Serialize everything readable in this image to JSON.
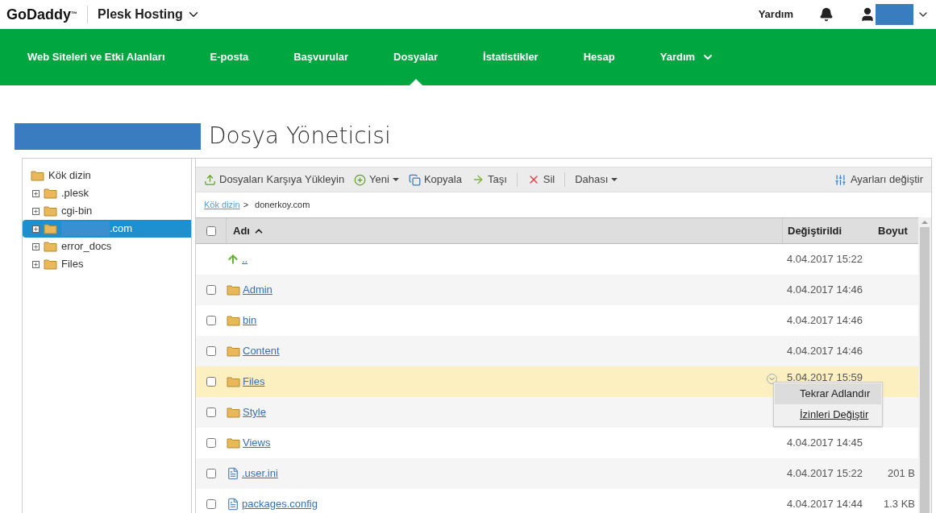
{
  "header": {
    "brand": "GoDaddy",
    "trademark": "™",
    "product": "Plesk Hosting",
    "help": "Yardım"
  },
  "nav": [
    {
      "label": "Web Siteleri ve Etki Alanları",
      "selected": false,
      "dropdown": false
    },
    {
      "label": "E-posta",
      "selected": false,
      "dropdown": false
    },
    {
      "label": "Başvurular",
      "selected": false,
      "dropdown": false
    },
    {
      "label": "Dosyalar",
      "selected": true,
      "dropdown": false
    },
    {
      "label": "İstatistikler",
      "selected": false,
      "dropdown": false
    },
    {
      "label": "Hesap",
      "selected": false,
      "dropdown": false
    },
    {
      "label": "Yardım",
      "selected": false,
      "dropdown": true
    }
  ],
  "page_title": "Dosya Yöneticisi",
  "tree": {
    "root": "Kök dizin",
    "children": [
      {
        "label": ".plesk",
        "selected": false,
        "redacted": false
      },
      {
        "label": "cgi-bin",
        "selected": false,
        "redacted": false
      },
      {
        "label": ".com",
        "selected": true,
        "redacted": true
      },
      {
        "label": "error_docs",
        "selected": false,
        "redacted": false
      },
      {
        "label": "Files",
        "selected": false,
        "redacted": false
      }
    ]
  },
  "toolbar": [
    {
      "label": "Dosyaları Karşıya Yükleyin",
      "kind": "upload"
    },
    {
      "label": "Yeni",
      "kind": "new"
    },
    {
      "label": "Kopyala",
      "kind": "copy"
    },
    {
      "label": "Taşı",
      "kind": "move"
    },
    {
      "label": "Sil",
      "kind": "delete"
    },
    {
      "label": "Dahası",
      "kind": "more"
    }
  ],
  "settings": "Ayarları değiştir",
  "breadcrumb": {
    "link": "Kök dizin",
    "separator": ">",
    "current": "donerkoy.com"
  },
  "table": {
    "select_all_checked": false,
    "columns": [
      "Adı",
      "Değiştirildi",
      "Boyut"
    ],
    "rows": [
      {
        "name": "..",
        "kind": "up",
        "modified": "4.04.2017 15:22",
        "size": "",
        "highlighted": false
      },
      {
        "checked": false,
        "name": "Admin",
        "kind": "folder",
        "modified": "4.04.2017 14:46",
        "size": "",
        "highlighted": false
      },
      {
        "checked": false,
        "name": "bin",
        "kind": "folder",
        "modified": "4.04.2017 14:46",
        "size": "",
        "highlighted": false
      },
      {
        "checked": false,
        "name": "Content",
        "kind": "folder",
        "modified": "4.04.2017 14:46",
        "size": "",
        "highlighted": false
      },
      {
        "checked": false,
        "name": "Files",
        "kind": "folder",
        "modified": "5.04.2017 15:59",
        "size": "",
        "highlighted": true
      },
      {
        "checked": false,
        "name": "Style",
        "kind": "folder",
        "modified": "",
        "size": "",
        "highlighted": false
      },
      {
        "checked": false,
        "name": "Views",
        "kind": "folder",
        "modified": "4.04.2017 14:45",
        "size": "",
        "highlighted": false
      },
      {
        "checked": false,
        "name": ".user.ini",
        "kind": "file",
        "modified": "4.04.2017 15:22",
        "size": "201 B",
        "highlighted": false
      },
      {
        "checked": false,
        "name": "packages.config",
        "kind": "file",
        "modified": "4.04.2017 14:44",
        "size": "1.3 KB",
        "highlighted": false
      }
    ]
  },
  "context_menu": [
    {
      "label": "Tekrar Adlandır",
      "selected": true
    },
    {
      "label": "İzinleri Değiştir",
      "selected": false
    }
  ]
}
